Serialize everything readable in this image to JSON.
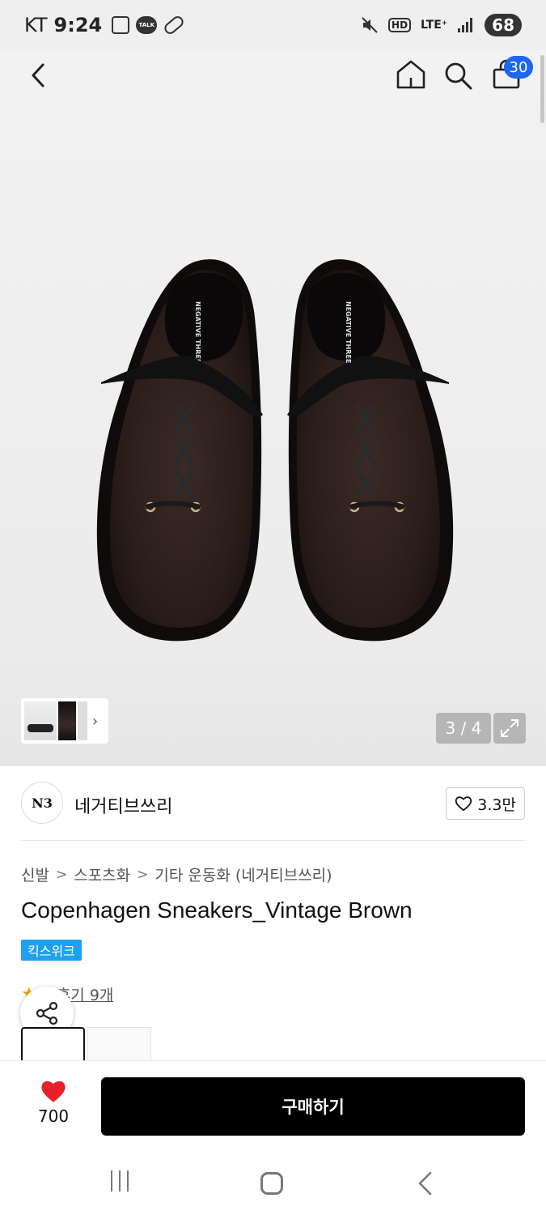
{
  "status_bar": {
    "carrier": "KT",
    "time": "9:24",
    "talk_label": "TALK",
    "hd_label": "HD",
    "network": "LTE⁺",
    "battery": "68"
  },
  "top_nav": {
    "cart_count": "30"
  },
  "gallery": {
    "pager": "3 / 4",
    "thumb_more_glyph": "›",
    "shoe_tongue_text": "NEGATIVE THREE"
  },
  "brand": {
    "logo_text": "N3",
    "name": "네거티브쓰리",
    "like_count": "3.3만"
  },
  "breadcrumb": {
    "items": [
      "신발",
      "스포츠화",
      "기타 운동화 (네거티브쓰리)"
    ],
    "separator": ">"
  },
  "product": {
    "title": "Copenhagen Sneakers_Vintage Brown",
    "badge": "킥스위크",
    "rating_partial": "9",
    "reviews": "후기 9개"
  },
  "buy_bar": {
    "heart_count": "700",
    "buy_label": "구매하기"
  },
  "colors": {
    "accent_blue": "#1f66f0",
    "badge_blue": "#1fa0f0",
    "heart_red": "#e8202a",
    "buy_black": "#000000"
  }
}
